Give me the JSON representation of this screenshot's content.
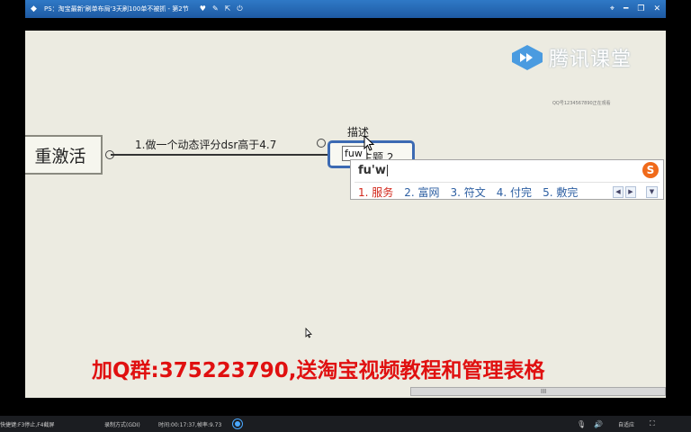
{
  "window": {
    "title": "PS：淘宝最新'刷单布局'3天刷100单不被抓 - 第2节",
    "title_icons": [
      "heart-icon",
      "edit-icon",
      "share-icon",
      "power-icon"
    ],
    "controls": [
      "pin-icon",
      "minimize-icon",
      "restore-icon",
      "close-icon"
    ]
  },
  "watermark": {
    "brand": "腾讯课堂",
    "small": "QQ号1234567890正在观看"
  },
  "mindmap": {
    "root_label": "重激活",
    "branch_label": "1.做一个动态评分dsr高于4.7",
    "desc_label": "描述",
    "subtopic_label": "主题 2",
    "input_value": "fuw"
  },
  "ime": {
    "composition": "fu'w",
    "candidates": [
      "1. 服务",
      "2. 富网",
      "3. 符文",
      "4. 付完",
      "5. 敷完"
    ],
    "logo": "S"
  },
  "promo_text": "加Q群:375223790,送淘宝视频教程和管理表格",
  "scrollbar": {
    "grip": "III"
  },
  "statusbar": {
    "hotkeys": "快捷键:F3停止,F4截屏",
    "mode": "录制方式(GDI)",
    "time": "时间:00:17:37,帧率:9.73",
    "adapt": "自适应"
  },
  "colors": {
    "titlebar": "#2f79c6",
    "canvas": "#ecebe1",
    "promo": "#e01010",
    "node_border": "#3c6ab3"
  }
}
